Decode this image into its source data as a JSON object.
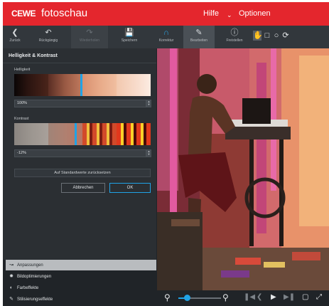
{
  "app": {
    "logo": "CEWE",
    "name": "fotoschau"
  },
  "menu": {
    "help": "Hilfe",
    "separator": "⌄",
    "options": "Optionen"
  },
  "toolbar": {
    "back": "Zurück",
    "undo": "Rückgängig",
    "redo": "Wiederholen",
    "save": "Speichern",
    "edit": "Korrektur",
    "adjust": "Bearbeiten",
    "info": "Freistellen"
  },
  "panel": {
    "title": "Helligkeit & Kontrast",
    "brightness": {
      "label": "Helligkeit",
      "value": "100%",
      "marker_position": 0.49
    },
    "contrast": {
      "label": "Kontrast",
      "value": "-12%",
      "marker_position": 0.44
    },
    "reset_label": "Auf Standardwerte zurücksetzen",
    "cancel_label": "Abbrechen",
    "ok_label": "OK"
  },
  "accordion": [
    {
      "label": "Anpassungen",
      "icon": "sliders-icon",
      "active": true
    },
    {
      "label": "Bildoptimierungen",
      "icon": "sun-icon",
      "active": false
    },
    {
      "label": "Farbeffekte",
      "icon": "palette-icon",
      "active": false
    },
    {
      "label": "Stilisierungseffekte",
      "icon": "brush-icon",
      "active": false
    }
  ],
  "colors": {
    "brand_red": "#e4262d",
    "accent_blue": "#20a3e6",
    "panel_bg": "#2b2f33",
    "app_bg": "#202428"
  }
}
